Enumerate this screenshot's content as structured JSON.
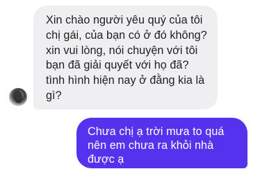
{
  "conversation": {
    "incoming": {
      "lines": [
        "Xin chào người yêu quý của tôi",
        "chị gái, của bạn có ở đó không?",
        "xin vui lòng, nói chuyện với tôi",
        "bạn đã giải quyết với họ đã?",
        "tình hình hiện nay ở đằng kia là",
        "gì?"
      ]
    },
    "outgoing": {
      "lines": [
        "Chưa chị ạ  trời mưa to quá",
        "nên em chưa ra khỏi nhà",
        "được ạ"
      ]
    }
  },
  "colors": {
    "incoming_bubble": "#efeff1",
    "outgoing_bubble": "#5533ee",
    "incoming_text": "#1e1e1e",
    "outgoing_text": "#ffffff"
  }
}
